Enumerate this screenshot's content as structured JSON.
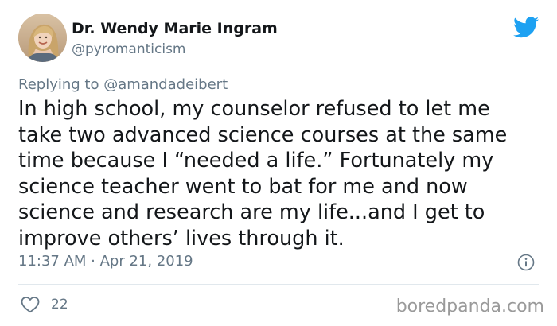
{
  "author": {
    "name": "Dr. Wendy Marie Ingram",
    "handle": "@pyromanticism",
    "avatar": "profile-photo"
  },
  "reply": {
    "prefix": "Replying to ",
    "mention": "@amandadeibert"
  },
  "tweet": {
    "lines": [
      "In high school, my counselor refused to let me",
      "take two advanced science courses at the same",
      "time because I “needed a life.” Fortunately my",
      "science teacher went to bat for me and now",
      "science and research are my life...and I get to",
      "improve others’ lives through it."
    ],
    "timestamp": "11:37 AM · Apr 21, 2019"
  },
  "stats": {
    "likes": "22"
  },
  "icons": {
    "brand": "twitter-bird-icon",
    "info": "info-icon",
    "like": "heart-icon"
  },
  "colors": {
    "twitter_blue": "#1da1f2",
    "secondary_text": "#657786",
    "primary_text": "#14171a"
  },
  "watermark": "boredpanda.com"
}
